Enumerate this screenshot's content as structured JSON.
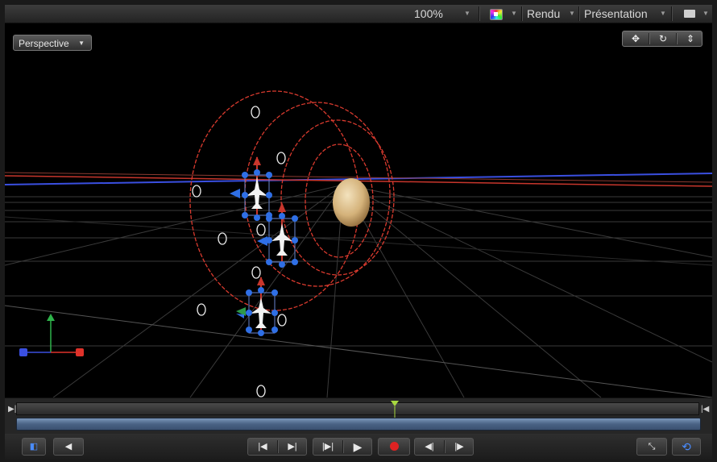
{
  "toolbar": {
    "zoom": "100%",
    "render_label": "Rendu",
    "presentation_label": "Présentation",
    "color_icon": "color-channels-icon",
    "layout_icon": "layout-icon"
  },
  "viewport": {
    "camera_menu_label": "Perspective",
    "view_controls": [
      "pan-icon",
      "orbit-icon",
      "dolly-icon"
    ]
  },
  "colors": {
    "x_axis": "#e0322a",
    "y_axis": "#2eb34a",
    "z_axis": "#3a4fe0",
    "handle": "#2f6fe6",
    "selection": "#d93a2e",
    "timeline_track": "#4a6284",
    "sphere": "#d9bf8c"
  },
  "timeline": {
    "in_marker": "in-point-icon",
    "out_marker": "out-point-icon",
    "playhead": "playhead-icon"
  },
  "transport": {
    "buttons": [
      "show-timing-icon",
      "audio-icon",
      "go-to-start-icon",
      "go-to-end-icon",
      "play-selection-icon",
      "play-icon",
      "record-icon",
      "previous-keyframe-icon",
      "next-keyframe-icon",
      "fullscreen-icon",
      "loop-icon"
    ]
  }
}
